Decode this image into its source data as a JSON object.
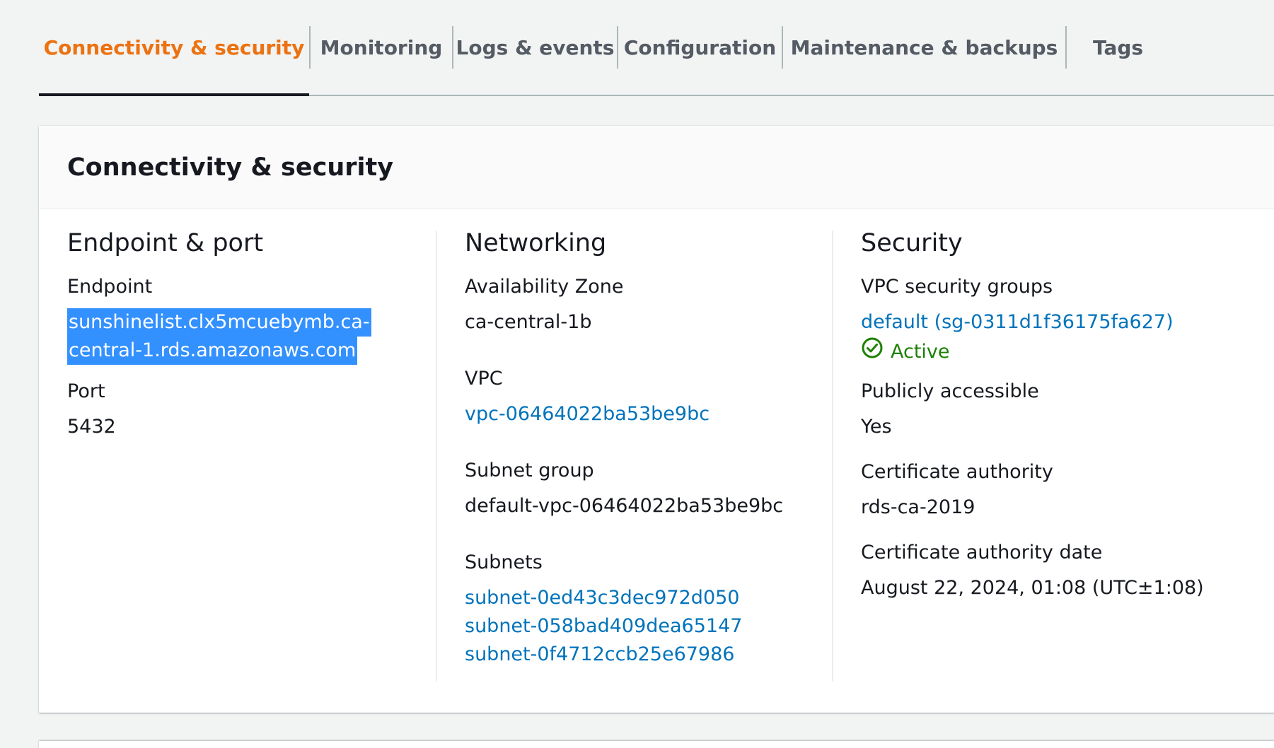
{
  "tabs": [
    {
      "label": "Connectivity & security",
      "active": true
    },
    {
      "label": "Monitoring",
      "active": false
    },
    {
      "label": "Logs & events",
      "active": false
    },
    {
      "label": "Configuration",
      "active": false
    },
    {
      "label": "Maintenance & backups",
      "active": false
    },
    {
      "label": "Tags",
      "active": false
    }
  ],
  "panel": {
    "title": "Connectivity & security",
    "endpoint_section": {
      "title": "Endpoint & port",
      "endpoint_label": "Endpoint",
      "endpoint_line1": "sunshinelist.clx5mcuebymb.ca-",
      "endpoint_line2": "central-1.rds.amazonaws.com",
      "port_label": "Port",
      "port_value": "5432"
    },
    "networking_section": {
      "title": "Networking",
      "az_label": "Availability Zone",
      "az_value": "ca-central-1b",
      "vpc_label": "VPC",
      "vpc_value": "vpc-06464022ba53be9bc",
      "subnet_group_label": "Subnet group",
      "subnet_group_value": "default-vpc-06464022ba53be9bc",
      "subnets_label": "Subnets",
      "subnets": [
        "subnet-0ed43c3dec972d050",
        "subnet-058bad409dea65147",
        "subnet-0f4712ccb25e67986"
      ]
    },
    "security_section": {
      "title": "Security",
      "sg_label": "VPC security groups",
      "sg_value": "default (sg-0311d1f36175fa627)",
      "sg_status": "Active",
      "public_label": "Publicly accessible",
      "public_value": "Yes",
      "ca_label": "Certificate authority",
      "ca_value": "rds-ca-2019",
      "ca_date_label": "Certificate authority date",
      "ca_date_value": "August 22, 2024, 01:08 (UTC±1:08)"
    }
  },
  "colors": {
    "active_tab": "#ec7211",
    "link": "#0073bb",
    "status_ok": "#1d8102",
    "selection": "#3390ff"
  },
  "icons": {
    "status": "check-circle-icon"
  }
}
